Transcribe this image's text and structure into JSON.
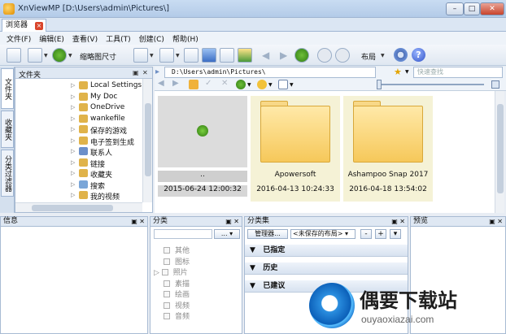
{
  "window": {
    "title": "XnViewMP [D:\\Users\\admin\\Pictures\\]",
    "min": "–",
    "max": "□",
    "close": "✕"
  },
  "tabs": [
    {
      "label": "浏览器",
      "close": "×"
    }
  ],
  "menu": [
    "文件(F)",
    "编辑(E)",
    "查看(V)",
    "工具(T)",
    "创建(C)",
    "帮助(H)"
  ],
  "toolbar": {
    "thumb_size": "缩略图尺寸",
    "layout": "布局",
    "help": "?"
  },
  "side_tabs": [
    "文件夹",
    "收藏夹",
    "分类过滤器"
  ],
  "folders_panel": {
    "title": "文件夹",
    "items": [
      {
        "label": "Local Settings",
        "icon_color": "#e0b34a"
      },
      {
        "label": "My Doc",
        "icon_color": "#e0b34a"
      },
      {
        "label": "OneDrive",
        "icon_color": "#e0b34a"
      },
      {
        "label": "wankefile",
        "icon_color": "#e0b34a"
      },
      {
        "label": "保存的游戏",
        "icon_color": "#e0b34a"
      },
      {
        "label": "电子签到生成",
        "icon_color": "#e0b34a"
      },
      {
        "label": "联系人",
        "icon_color": "#6c8fc9"
      },
      {
        "label": "链接",
        "icon_color": "#e0b34a"
      },
      {
        "label": "收藏夹",
        "icon_color": "#e0b34a"
      },
      {
        "label": "搜索",
        "icon_color": "#7aa6d8"
      },
      {
        "label": "我的视频",
        "icon_color": "#e0b34a"
      }
    ]
  },
  "address": {
    "path": "D:\\Users\\admin\\Pictures\\",
    "search_placeholder": "快速查找"
  },
  "files": [
    {
      "name": "..",
      "date": "2015-06-24 12:00:32",
      "type": "parent"
    },
    {
      "name": "Apowersoft",
      "date": "2016-04-13 10:24:33",
      "type": "folder"
    },
    {
      "name": "Ashampoo Snap 2017",
      "date": "2016-04-18 13:54:02",
      "type": "folder"
    }
  ],
  "info_panel": {
    "title": "信息"
  },
  "category_panel": {
    "title": "分类",
    "button": "...",
    "items": [
      "其他",
      "图标",
      "照片",
      "素描",
      "绘画",
      "视频",
      "音频"
    ]
  },
  "category_set_panel": {
    "title": "分类集",
    "manager": "管理器...",
    "layout_select": "<未保存的布局>",
    "minus": "-",
    "plus": "+",
    "sections": [
      "已指定",
      "历史",
      "已建议"
    ]
  },
  "preview_panel": {
    "title": "预览"
  },
  "watermark": {
    "title": "偶要下载站",
    "url": "ouyaoxiazai.com"
  },
  "colors": {
    "accent": "#2b5fb8",
    "folder": "#f6c85a",
    "selected": "#f5f2d6"
  }
}
